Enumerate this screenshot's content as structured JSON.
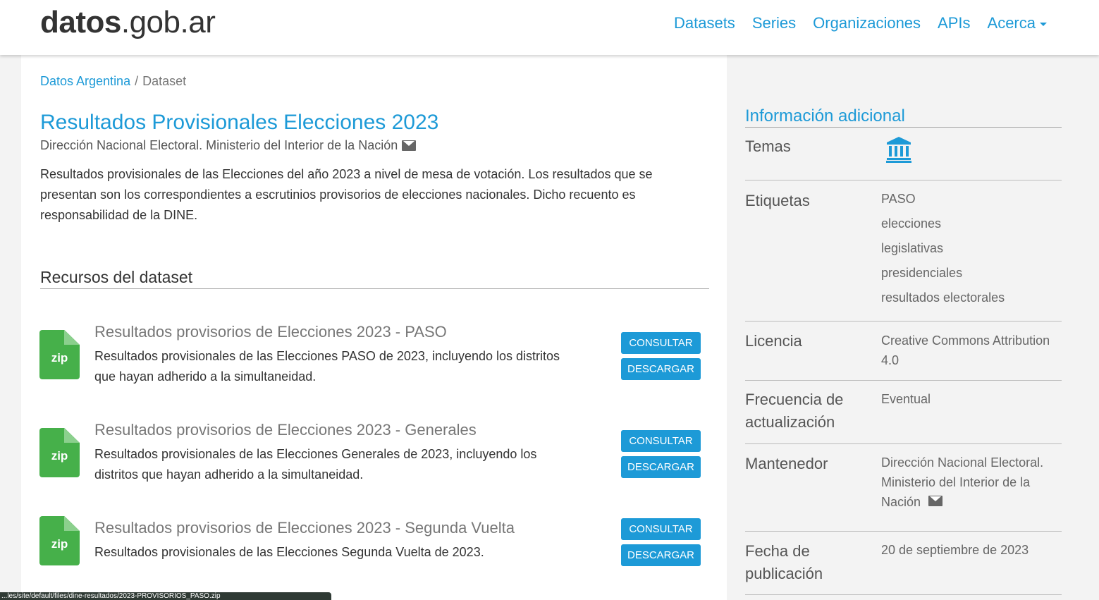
{
  "navbar": {
    "brand_bold": "datos",
    "brand_rest": ".gob.ar",
    "links": [
      "Datasets",
      "Series",
      "Organizaciones",
      "APIs",
      "Acerca"
    ]
  },
  "breadcrumb": {
    "home": "Datos Argentina",
    "separator": "/",
    "current": "Dataset"
  },
  "dataset": {
    "title": "Resultados Provisionales Elecciones 2023",
    "publisher": "Dirección Nacional Electoral. Ministerio del Interior de la Nación",
    "description": "Resultados provisionales de las Elecciones del año 2023 a nivel de mesa de votación. Los resultados que se presentan son los correspondientes a escrutinios provisorios de elecciones nacionales. Dicho recuento es responsabilidad de la DINE."
  },
  "resources_section": {
    "title": "Recursos del dataset",
    "consult_label": "CONSULTAR",
    "download_label": "DESCARGAR",
    "items": [
      {
        "format": "zip",
        "title": "Resultados provisorios de Elecciones 2023 - PASO",
        "description": "Resultados provisionales de las Elecciones PASO de 2023, incluyendo los distritos que hayan adherido a la simultaneidad."
      },
      {
        "format": "zip",
        "title": "Resultados provisorios de Elecciones 2023 - Generales",
        "description": "Resultados provisionales de las Elecciones Generales de 2023, incluyendo los distritos que hayan adherido a la simultaneidad."
      },
      {
        "format": "zip",
        "title": "Resultados provisorios de Elecciones 2023 - Segunda Vuelta",
        "description": "Resultados provisionales de las Elecciones Segunda Vuelta de 2023."
      }
    ]
  },
  "sidebar": {
    "title": "Información adicional",
    "temas_label": "Temas",
    "temas_icon": "government-building-icon",
    "etiquetas_label": "Etiquetas",
    "tags": [
      "PASO",
      "elecciones",
      "legislativas",
      "presidenciales",
      "resultados electorales"
    ],
    "licencia_label": "Licencia",
    "licencia_value": "Creative Commons Attribution 4.0",
    "frecuencia_label": "Frecuencia de actualización",
    "frecuencia_value": "Eventual",
    "mantenedor_label": "Mantenedor",
    "mantenedor_value": "Dirección Nacional Electoral. Ministerio del Interior de la Nación",
    "fecha_label": "Fecha de publicación",
    "fecha_value": "20 de septiembre de 2023"
  },
  "statusbar": {
    "url_text": "...les/site/default/files/dine-resultados/2023-PROVISORIOS_PASO.zip"
  },
  "colors": {
    "accent": "#1d9ad7",
    "zip_green": "#46b04a",
    "status_bar": "#2f3a34"
  }
}
